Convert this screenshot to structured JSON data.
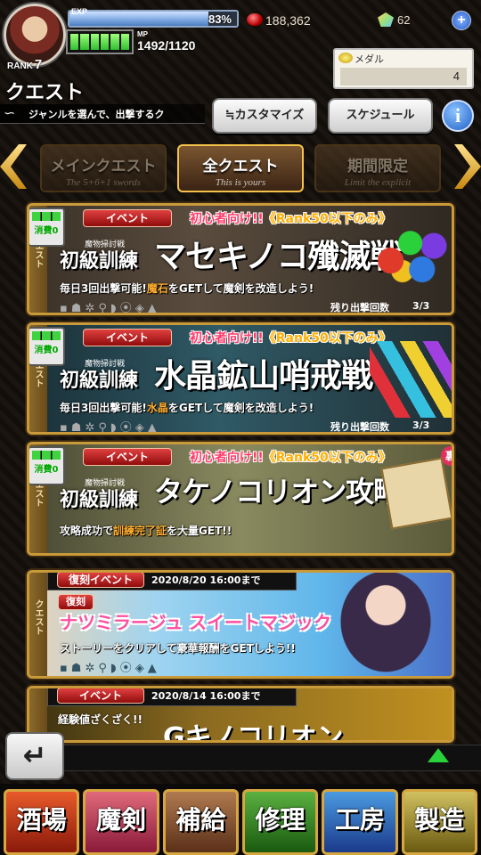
{
  "header": {
    "exp_label": "EXP",
    "exp_percent": "83%",
    "exp_fill": 0.83,
    "mp_label": "MP",
    "mp_value": "1492/1120",
    "rank_label": "RANK",
    "rank_value": "7",
    "gems": "188,362",
    "crystals": "62",
    "plus": "+"
  },
  "medal": {
    "label": "メダル",
    "value": "4"
  },
  "page": {
    "title": "クエスト",
    "subtitle": "ジャンルを選んで、出撃するク"
  },
  "buttons": {
    "customize": "≒カスタマイズ",
    "schedule": "スケジュール",
    "info": "i"
  },
  "tabs": [
    {
      "label": "メインクエスト",
      "sub": "The 5+6+1 swords"
    },
    {
      "label": "全クエスト",
      "sub": "This is yours"
    },
    {
      "label": "期間限定",
      "sub": "Limit the explicit"
    }
  ],
  "quests": [
    {
      "side": "クエスト",
      "type": "イベント",
      "beginner": "初心者向け!!",
      "rank": "《Rank50以下のみ》",
      "cost": "消費0",
      "small": "魔物掃討戦",
      "t1": "初級訓練",
      "t2": "マセキノコ殲滅戦",
      "desc_pre": "毎日3回出撃可能!",
      "desc_hl": "魔石",
      "desc_post": "をGETして魔剣を改造しよう!",
      "remain_label": "残り出撃回数",
      "remain": "3/3"
    },
    {
      "side": "クエスト",
      "type": "イベント",
      "beginner": "初心者向け!!",
      "rank": "《Rank50以下のみ》",
      "cost": "消費0",
      "small": "魔物掃討戦",
      "t1": "初級訓練",
      "t2": "水晶鉱山哨戒戦",
      "desc_pre": "毎日3回出撃可能!",
      "desc_hl": "水晶",
      "desc_post": "をGETして魔剣を改造しよう!",
      "remain_label": "残り出撃回数",
      "remain": "3/3"
    },
    {
      "side": "クエスト",
      "type": "イベント",
      "beginner": "初心者向け!!",
      "rank": "《Rank50以下のみ》",
      "cost": "消費0",
      "small": "魔物掃討戦",
      "t1": "初級訓練",
      "t2": "タケノコリオン攻略戦",
      "desc_pre": "攻略成功で",
      "desc_hl": "訓練完了証",
      "desc_post": "を大量GET!!",
      "badge": "裏"
    },
    {
      "side": "クエスト",
      "type": "復刻イベント",
      "date": "2020/8/20  16:00まで",
      "tag": "復刻",
      "t2": "ナツミラージュ スイートマジック",
      "desc": "ストーリーをクリアして豪華報酬をGETしよう!!"
    },
    {
      "side": "クエスト",
      "type": "イベント",
      "date": "2020/8/14  16:00まで",
      "tag": "経験値ざくざく!!",
      "t2": "Gキノコリオン"
    }
  ],
  "nav": [
    "酒場",
    "魔剣",
    "補給",
    "修理",
    "工房",
    "製造"
  ],
  "back": "↵"
}
